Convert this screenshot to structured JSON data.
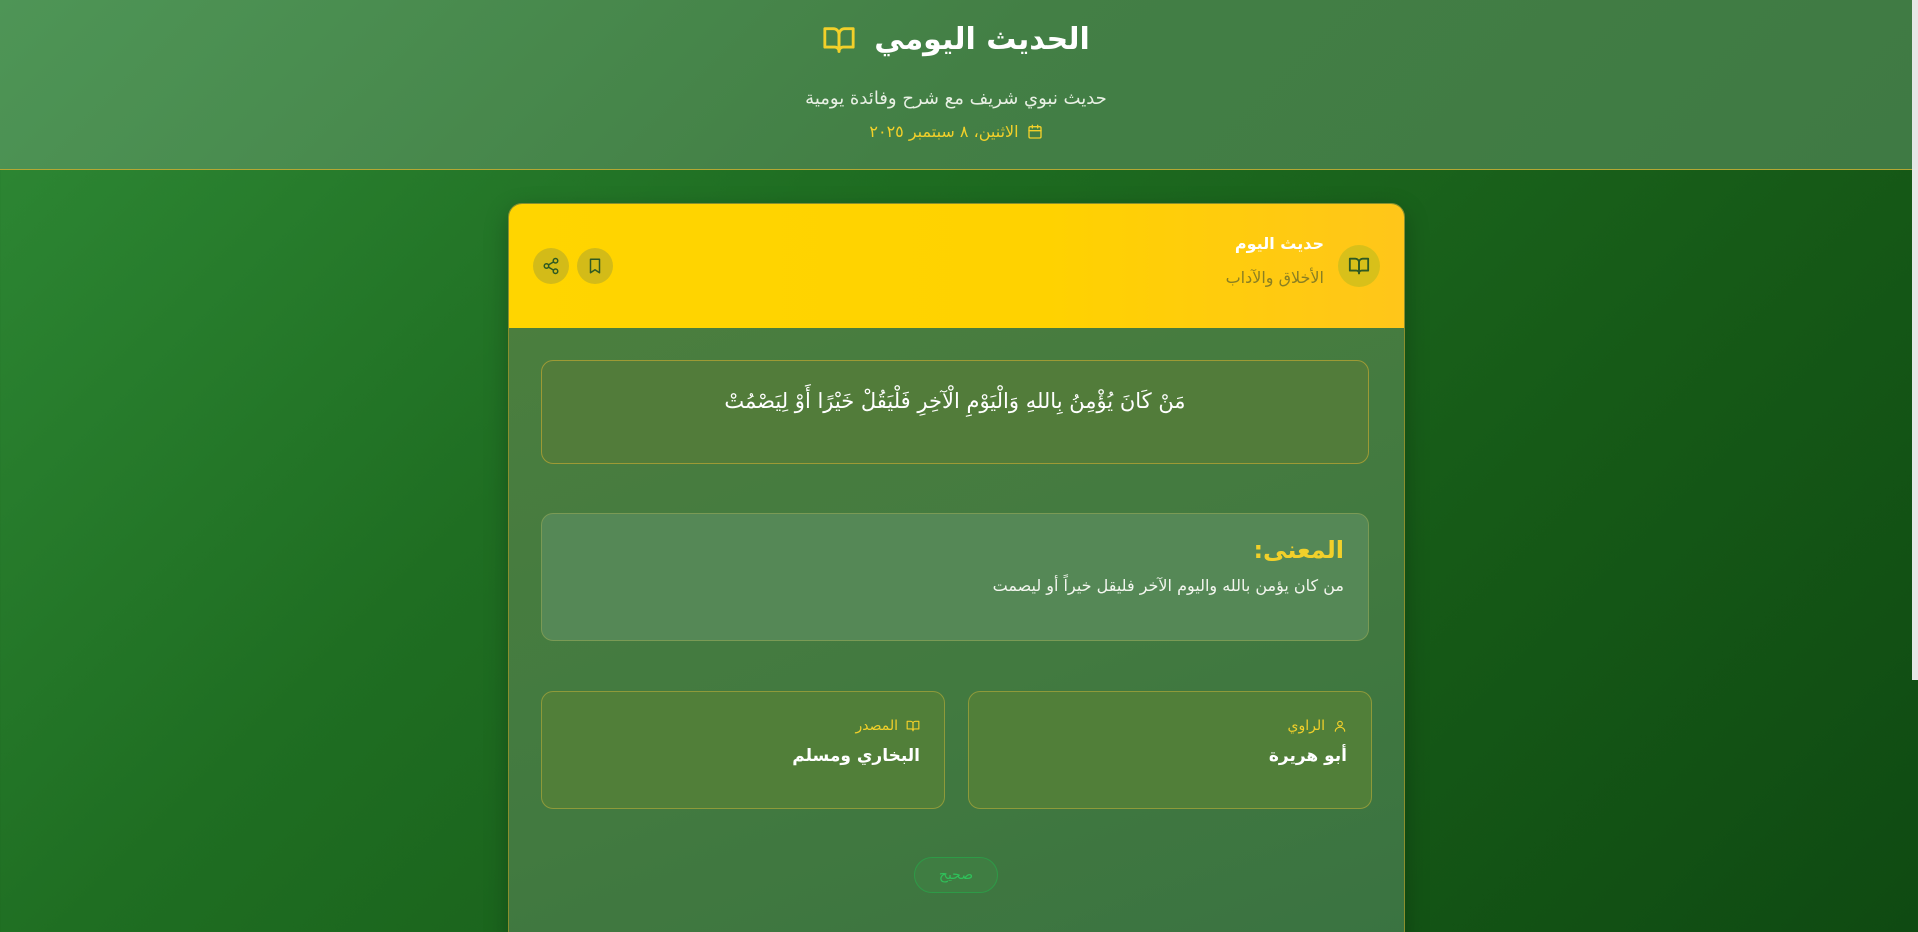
{
  "header": {
    "title": "الحديث اليومي",
    "subtitle": "حديث نبوي شريف مع شرح وفائدة يومية",
    "date": "الاثنين، ٨ سبتمبر ٢٠٢٥",
    "title_icon": "book-open-icon",
    "date_icon": "calendar-icon"
  },
  "card": {
    "top_title": "حديث اليوم",
    "category": "الأخلاق والآداب",
    "icon": "book-open-icon",
    "actions": {
      "share_icon": "share-icon",
      "bookmark_icon": "bookmark-icon"
    },
    "hadith_text": "مَنْ كَانَ يُؤْمِنُ بِاللهِ وَالْيَوْمِ الْآخِرِ فَلْيَقُلْ خَيْرًا أَوْ لِيَصْمُتْ",
    "meaning": {
      "label": "المعنى:",
      "text": "من كان يؤمن بالله واليوم الآخر فليقل خيراً أو ليصمت"
    },
    "narrator": {
      "label": "الراوي",
      "value": "أبو هريرة",
      "icon": "user-icon"
    },
    "source": {
      "label": "المصدر",
      "value": "البخاري ومسلم",
      "icon": "book-open-icon"
    },
    "grade": "صحيح"
  },
  "colors": {
    "accent_yellow": "#ffd500",
    "gold_text": "#f2d02a",
    "grade_green": "#2fc15a"
  }
}
